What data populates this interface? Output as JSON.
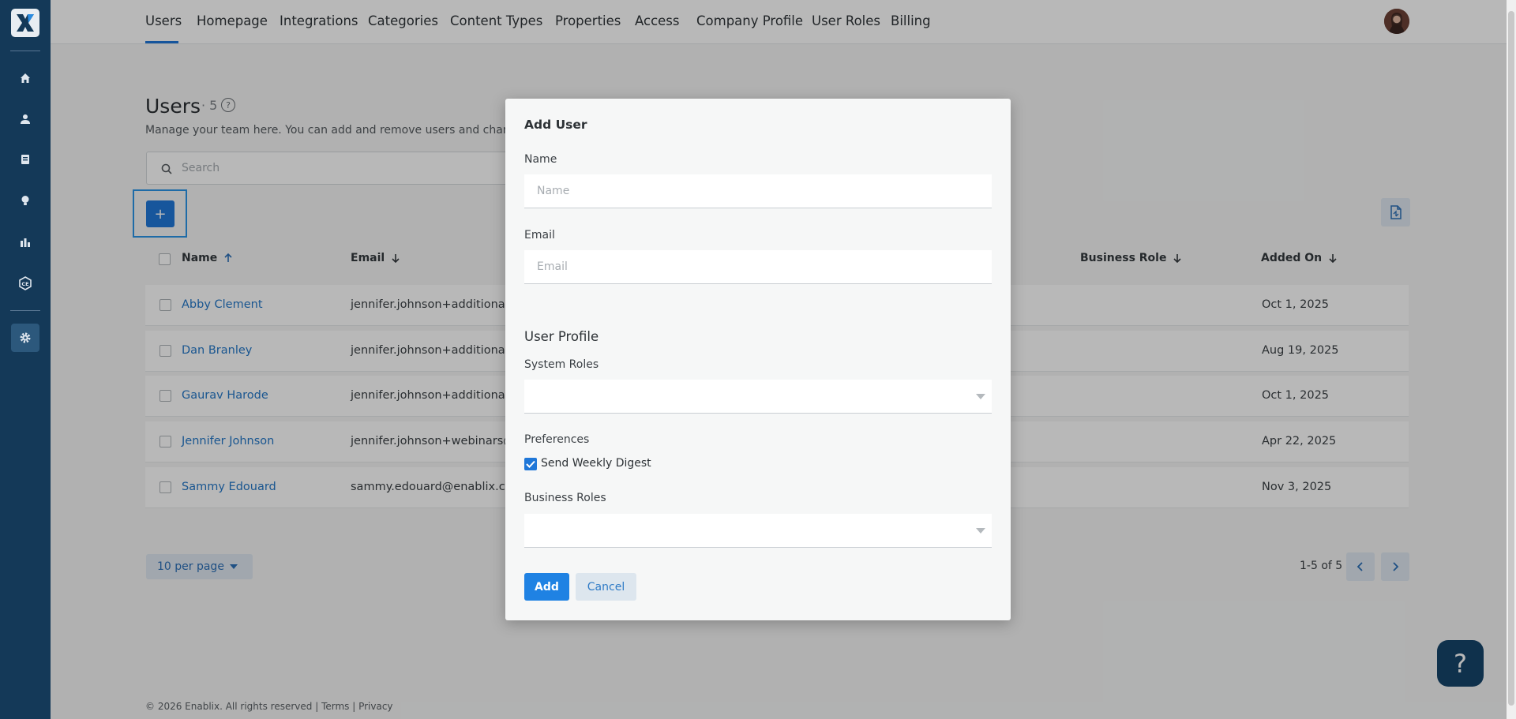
{
  "nav": {
    "tabs": [
      "Users",
      "Homepage",
      "Integrations",
      "Categories",
      "Content Types",
      "Properties",
      "Access",
      "Company Profile",
      "User Roles",
      "Billing"
    ]
  },
  "page": {
    "title": "Users",
    "count": "· 5",
    "help": "?",
    "subtitle": "Manage your team here. You can add and remove users and change their roles.",
    "search_placeholder": "Search",
    "add_label": "+"
  },
  "table": {
    "headers": [
      "Name",
      "Email",
      "Business Role",
      "Added On"
    ],
    "rows": [
      {
        "name": "Abby Clement",
        "email": "jennifer.johnson+additionaluser",
        "date": "Oct 1, 2025"
      },
      {
        "name": "Dan Branley",
        "email": "jennifer.johnson+additionaluser",
        "date": "Aug 19, 2025"
      },
      {
        "name": "Gaurav Harode",
        "email": "jennifer.johnson+additionaluser",
        "date": "Oct 1, 2025"
      },
      {
        "name": "Jennifer Johnson",
        "email": "jennifer.johnson+webinars@en",
        "date": "Apr 22, 2025"
      },
      {
        "name": "Sammy Edouard",
        "email": "sammy.edouard@enablix.com",
        "date": "Nov 3, 2025"
      }
    ]
  },
  "pagination": {
    "per_page": "10 per page",
    "info": "1-5 of 5"
  },
  "footer": {
    "text": "© 2026 Enablix. All rights reserved | Terms | Privacy"
  },
  "fab": {
    "label": "?"
  },
  "modal": {
    "title": "Add User",
    "name_label": "Name",
    "name_placeholder": "Name",
    "email_label": "Email",
    "email_placeholder": "Email",
    "section": "User Profile",
    "system_roles_label": "System Roles",
    "preferences_label": "Preferences",
    "weekly_digest_label": "Send Weekly Digest",
    "weekly_digest_checked": true,
    "business_roles_label": "Business Roles",
    "add_button": "Add",
    "cancel_button": "Cancel"
  },
  "colors": {
    "rail": "#143958",
    "accent": "#1f77d8",
    "link": "#2478c8"
  }
}
